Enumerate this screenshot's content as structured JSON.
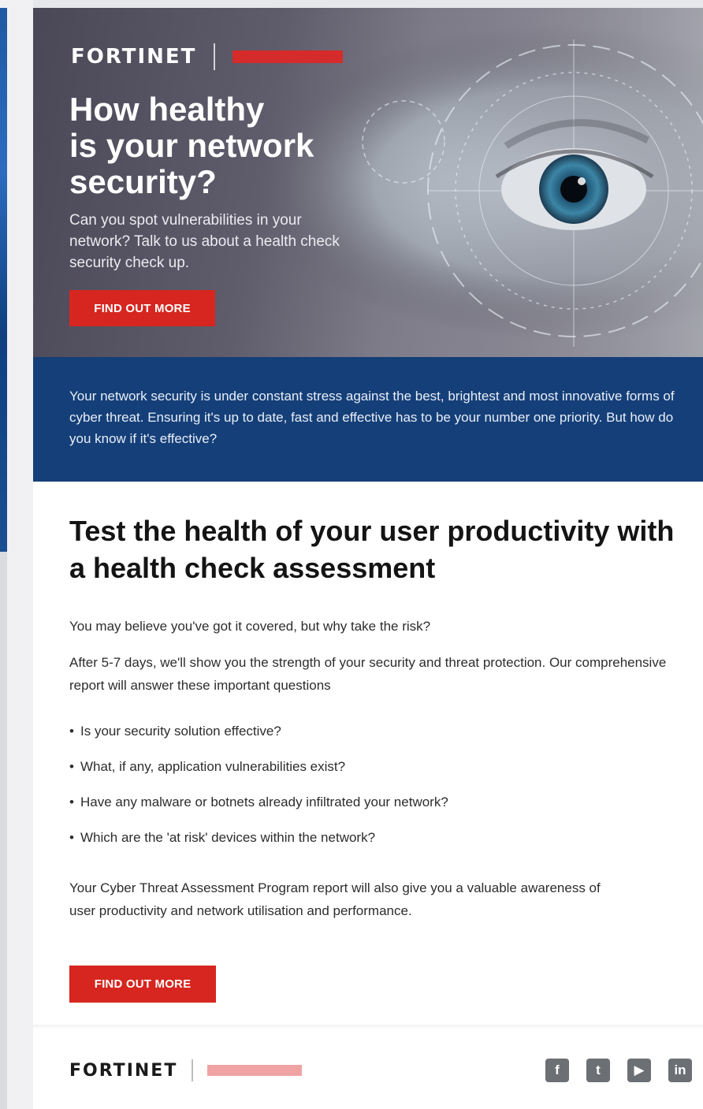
{
  "hero": {
    "brand": "FORTINET",
    "title_line1": "How healthy",
    "title_line2": "is your network",
    "title_line3": "security?",
    "subtitle": "Can you spot vulnerabilities in your network? Talk to us about a health check security check up.",
    "cta_label": "FIND OUT MORE"
  },
  "intro": {
    "text": "Your network security is under constant stress against the best, brightest and most innovative forms of cyber threat. Ensuring it's up to date, fast and effective has to be your number one priority. But how do you know if it's effective?"
  },
  "content": {
    "heading": "Test the health of your user productivity with a health check assessment",
    "paragraph1": "You may believe you've got it covered, but why take the risk?",
    "paragraph2": "After 5-7 days, we'll show you the strength of your security and threat protection. Our comprehensive report will answer these important questions",
    "bullets": [
      "Is your security solution effective?",
      "What, if any, application vulnerabilities exist?",
      "Have any malware or botnets already infiltrated your network?",
      "Which are the 'at risk' devices within the network?"
    ],
    "bullet_symbol": "•",
    "paragraph3": "Your Cyber Threat Assessment Program report will also give you a valuable awareness of user productivity and network utilisation and performance.",
    "cta_label": "FIND OUT MORE"
  },
  "footer": {
    "brand": "FORTINET",
    "social": [
      {
        "icon": "facebook-icon",
        "glyph": "f"
      },
      {
        "icon": "twitter-icon",
        "glyph": "t"
      },
      {
        "icon": "youtube-icon",
        "glyph": "▶"
      },
      {
        "icon": "linkedin-icon",
        "glyph": "in"
      }
    ]
  },
  "colors": {
    "brand_red": "#d6261f",
    "band_blue": "#153f78"
  }
}
